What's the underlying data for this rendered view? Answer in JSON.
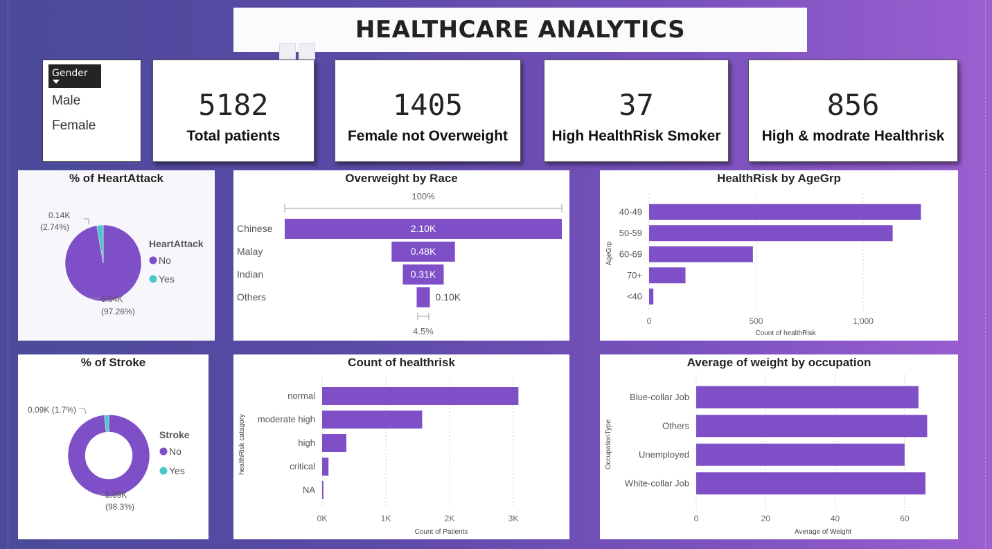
{
  "header": {
    "title": "HEALTHCARE ANALYTICS"
  },
  "slicer": {
    "title": "Gender",
    "items": [
      "Male",
      "Female"
    ]
  },
  "kpis": [
    {
      "value": "5182",
      "label": "Total patients"
    },
    {
      "value": "1405",
      "label": "Female not Overweight"
    },
    {
      "value": "37",
      "label": "High HealthRisk Smoker"
    },
    {
      "value": "856",
      "label": "High & modrate Healthrisk"
    }
  ],
  "colors": {
    "primary": "#7e4fc6",
    "secondary": "#4cc7c7"
  },
  "chart_data": [
    {
      "id": "heartattack",
      "type": "pie",
      "title": "% of HeartAttack",
      "legend_title": "HeartAttack",
      "slices": [
        {
          "name": "No",
          "value": 5040,
          "pct": 97.26,
          "label": "5.04K",
          "pct_label": "(97.26%)"
        },
        {
          "name": "Yes",
          "value": 140,
          "pct": 2.74,
          "label": "0.14K",
          "pct_label": "(2.74%)"
        }
      ]
    },
    {
      "id": "race",
      "type": "funnel",
      "title": "Overweight by Race",
      "top_label": "100%",
      "bottom_label": "4.5%",
      "categories": [
        "Chinese",
        "Malay",
        "Indian",
        "Others"
      ],
      "values": [
        2100,
        480,
        310,
        100
      ],
      "value_labels": [
        "2.10K",
        "0.48K",
        "0.31K",
        "0.10K"
      ]
    },
    {
      "id": "agegrp",
      "type": "bar",
      "orientation": "horizontal",
      "title": "HealthRisk by AgeGrp",
      "ylabel": "AgeGrp",
      "xlabel": "Count of healthRisk",
      "categories": [
        "40-49",
        "50-59",
        "60-69",
        "70+",
        "<40"
      ],
      "values": [
        1270,
        1138,
        485,
        170,
        20
      ],
      "xlim": [
        0,
        1450
      ],
      "ticks": [
        0,
        500,
        1000
      ],
      "tick_labels": [
        "0",
        "500",
        "1,000"
      ],
      "grid": true
    },
    {
      "id": "stroke",
      "type": "pie",
      "donut": true,
      "title": "% of Stroke",
      "legend_title": "Stroke",
      "slices": [
        {
          "name": "No",
          "value": 5090,
          "pct": 98.3,
          "label": "5.09K",
          "pct_label": "(98.3%)"
        },
        {
          "name": "Yes",
          "value": 90,
          "pct": 1.7,
          "label": "0.09K (1.7%)",
          "pct_label": ""
        }
      ]
    },
    {
      "id": "healthrisk",
      "type": "bar",
      "orientation": "horizontal",
      "title": "Count of healthrisk",
      "ylabel": "healthRisk catagory",
      "xlabel": "Count of Patients",
      "categories": [
        "normal",
        "moderate high",
        "high",
        "critical",
        "NA"
      ],
      "values": [
        3080,
        1570,
        380,
        100,
        20
      ],
      "xlim": [
        0,
        3500
      ],
      "ticks": [
        0,
        1000,
        2000,
        3000
      ],
      "tick_labels": [
        "0K",
        "1K",
        "2K",
        "3K"
      ],
      "grid": true
    },
    {
      "id": "occupation",
      "type": "bar",
      "orientation": "horizontal",
      "title": "Average of weight by occupation",
      "ylabel": "OccupationType",
      "xlabel": "Average of Weight",
      "categories": [
        "Blue-collar Job",
        "Others",
        "Unemployed",
        "White-collar Job"
      ],
      "values": [
        64,
        66.5,
        60,
        66
      ],
      "xlim": [
        0,
        72
      ],
      "ticks": [
        0,
        20,
        40,
        60
      ],
      "tick_labels": [
        "0",
        "20",
        "40",
        "60"
      ],
      "grid": true
    }
  ]
}
